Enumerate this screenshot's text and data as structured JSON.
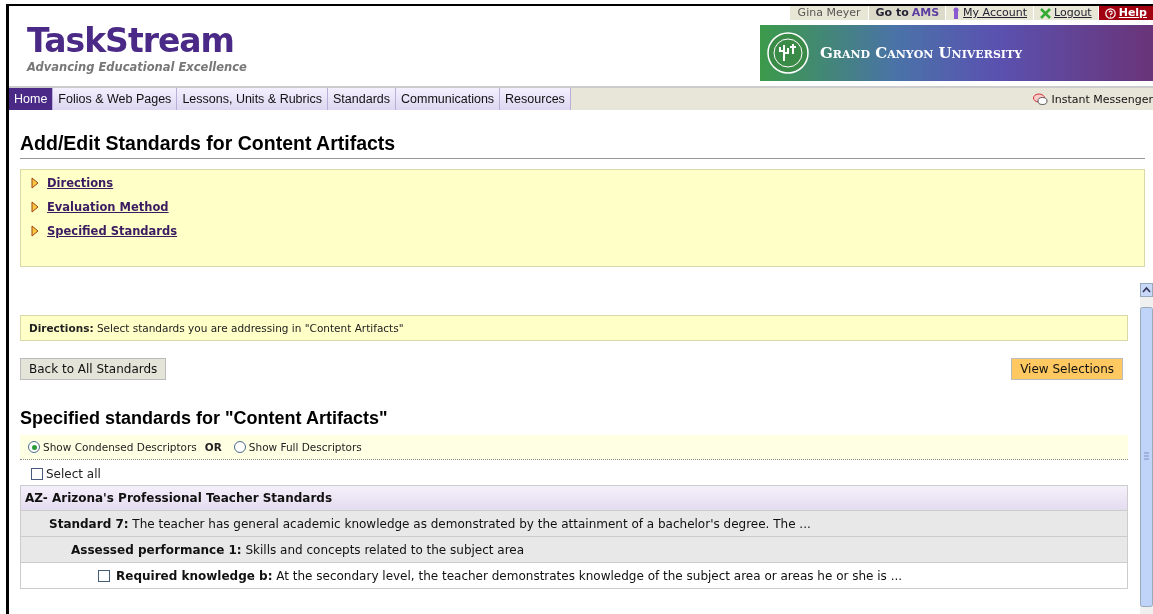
{
  "top_bar": {
    "user": "Gina Meyer",
    "links": [
      {
        "kind": "ams",
        "prefix": "Go to",
        "label": "AMS"
      },
      {
        "kind": "account",
        "label": "My Account"
      },
      {
        "kind": "logout",
        "label": "Logout"
      },
      {
        "kind": "help",
        "label": "Help"
      }
    ]
  },
  "logo": {
    "name": "TaskStream",
    "tagline": "Advancing Educational Excellence"
  },
  "banner": {
    "title": "Grand Canyon University"
  },
  "nav": {
    "tabs": [
      {
        "label": "Home",
        "selected": true
      },
      {
        "label": "Folios & Web Pages",
        "selected": false
      },
      {
        "label": "Lessons, Units & Rubrics",
        "selected": false
      },
      {
        "label": "Standards",
        "selected": false
      },
      {
        "label": "Communications",
        "selected": false
      },
      {
        "label": "Resources",
        "selected": false
      }
    ],
    "messenger": "Instant Messenger"
  },
  "page_title": "Add/Edit Standards for Content Artifacts",
  "sections": [
    "Directions",
    "Evaluation Method",
    "Specified Standards"
  ],
  "directions": {
    "label": "Directions:",
    "text": "Select standards you are addressing in \"Content Artifacts\""
  },
  "buttons": {
    "back": "Back to All Standards",
    "view": "View Selections"
  },
  "heading": "Specified standards for \"Content Artifacts\"",
  "descriptors": {
    "options": [
      {
        "label": "Show Condensed Descriptors",
        "selected": true
      },
      {
        "label": "Show Full Descriptors",
        "selected": false
      }
    ],
    "separator": "OR"
  },
  "select_all": {
    "label": "Select all",
    "checked": false
  },
  "rows": [
    {
      "kind": "group",
      "label": "AZ- Arizona's Professional Teacher Standards"
    },
    {
      "kind": "standard",
      "label": "Standard 7:",
      "text": "The teacher has general academic knowledge as demonstrated by the attainment of a bachelor's degree. The ..."
    },
    {
      "kind": "performance",
      "label": "Assessed performance 1:",
      "text": "Skills and concepts related to the subject area"
    },
    {
      "kind": "knowledge",
      "label": "Required knowledge b:",
      "text": "At the secondary level, the teacher demonstrates knowledge of the subject area or areas he or she is ...",
      "checked": false
    }
  ]
}
